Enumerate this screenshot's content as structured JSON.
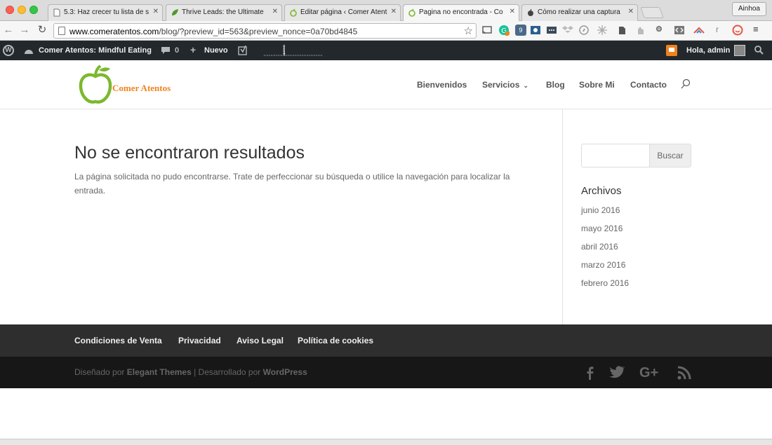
{
  "browser": {
    "tabs": [
      {
        "title": "5.3: Haz crecer tu lista de s"
      },
      {
        "title": "Thrive Leads: the Ultimate"
      },
      {
        "title": "Editar página ‹ Comer Atent"
      },
      {
        "title": "Pagina no encontrada - Co"
      },
      {
        "title": "Cómo realizar una captura"
      }
    ],
    "profile": "Ainhoa",
    "url_host": "www.comeratentos.com",
    "url_path": "/blog/?preview_id=563&preview_nonce=0a70bd4845",
    "ext_badge": "9"
  },
  "wp_admin_bar": {
    "site_name": "Comer Atentos: Mindful Eating",
    "comments_count": "0",
    "new_label": "Nuevo",
    "greeting": "Hola, admin"
  },
  "site": {
    "logo_text": "Comer Atentos",
    "nav": [
      {
        "label": "Bienvenidos"
      },
      {
        "label": "Servicios"
      },
      {
        "label": "Blog"
      },
      {
        "label": "Sobre Mi"
      },
      {
        "label": "Contacto"
      }
    ]
  },
  "content": {
    "title": "No se encontraron resultados",
    "text": "La página solicitada no pudo encontrarse. Trate de perfeccionar su búsqueda o utilice la navegación para localizar la entrada."
  },
  "sidebar": {
    "search_button": "Buscar",
    "archives_title": "Archivos",
    "archives": [
      {
        "label": "junio 2016"
      },
      {
        "label": "mayo 2016"
      },
      {
        "label": "abril 2016"
      },
      {
        "label": "marzo 2016"
      },
      {
        "label": "febrero 2016"
      }
    ]
  },
  "footer": {
    "links": [
      {
        "label": "Condiciones de Venta"
      },
      {
        "label": "Privacidad"
      },
      {
        "label": "Aviso Legal"
      },
      {
        "label": "Política de cookies"
      }
    ],
    "credit_prefix": "Diseñado por",
    "credit_theme": "Elegant Themes",
    "credit_sep": "| Desarrollado por",
    "credit_cms": "WordPress"
  },
  "colors": {
    "accent_orange": "#f0821e",
    "logo_green": "#7cb82f",
    "wp_bar": "#23282d",
    "footer_nav": "#2e2e2e",
    "footer_bottom": "#171717"
  }
}
